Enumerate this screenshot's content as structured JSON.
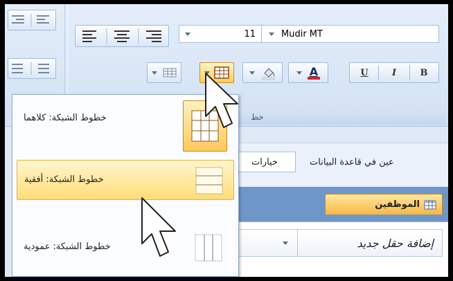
{
  "ribbon": {
    "font": {
      "name": "Mudir MT",
      "size": "11",
      "group_label": "خط",
      "bold": "B",
      "italic": "I",
      "underline": "U",
      "font_color_letter": "A"
    }
  },
  "gridlines_menu": {
    "items": [
      {
        "label": "خطوط الشبكة: كلاهما"
      },
      {
        "label": "خطوط الشبكة: أفقية"
      },
      {
        "label": "خطوط الشبكة: عمودية"
      }
    ]
  },
  "options_bar": {
    "options_button": "خيارات",
    "text": "عين في قاعدة البيانات"
  },
  "table_tab": {
    "label": "الموظفين"
  },
  "datasheet": {
    "add_field": "إضافة حقل جديد"
  },
  "colors": {
    "accent_orange": "#f7b741",
    "ribbon_blue": "#d2e1f3",
    "font_color_red": "#e02020"
  }
}
